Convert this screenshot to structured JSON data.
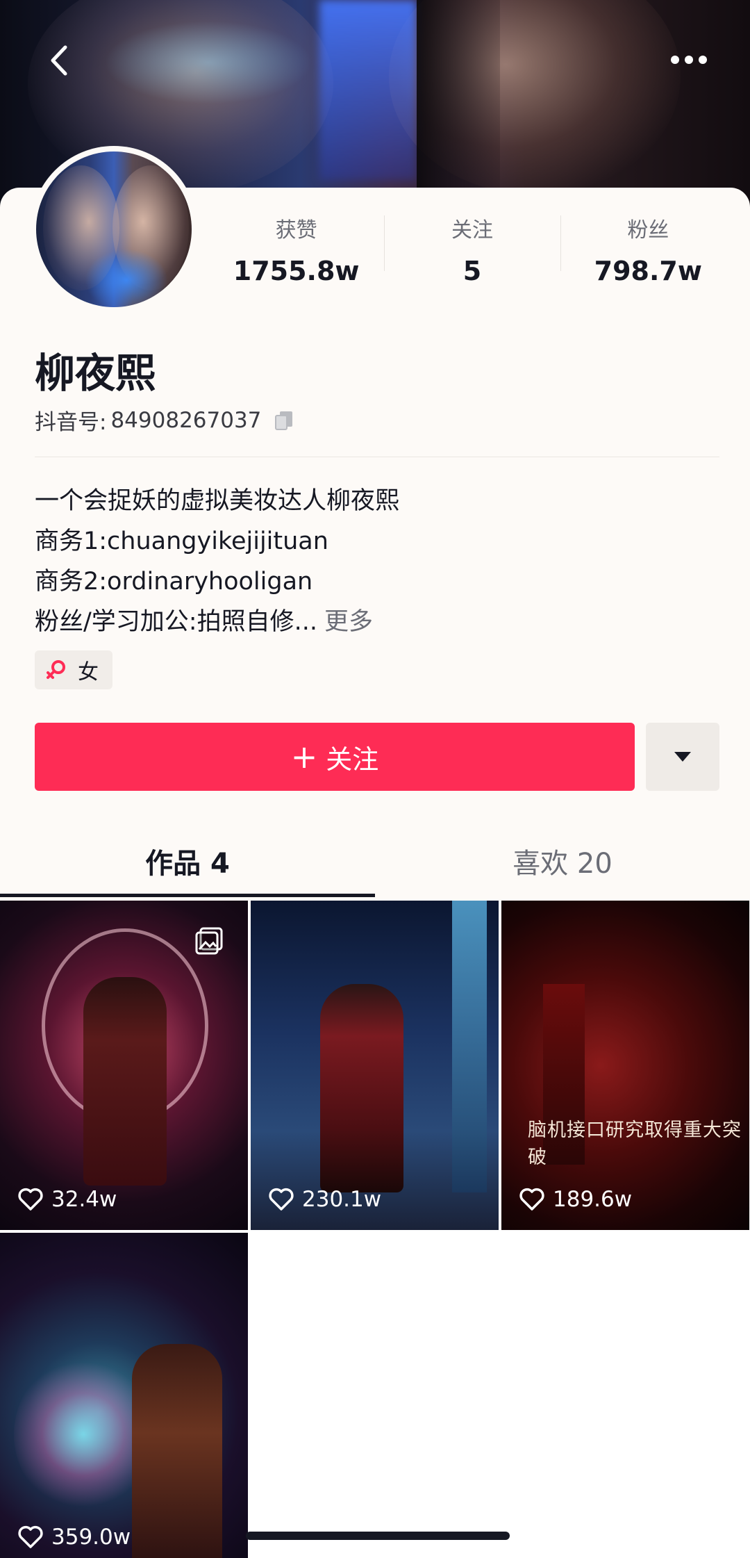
{
  "header": {
    "back_icon": "chevron-left-icon",
    "more_icon": "more-dots-icon"
  },
  "profile": {
    "stats": [
      {
        "label": "获赞",
        "value": "1755.8w"
      },
      {
        "label": "关注",
        "value": "5"
      },
      {
        "label": "粉丝",
        "value": "798.7w"
      }
    ],
    "name": "柳夜熙",
    "uid_label": "抖音号:",
    "uid_value": "84908267037",
    "bio_lines": [
      "一个会捉妖的虚拟美妆达人柳夜熙",
      "商务1:chuangyikejijituan",
      "商务2:ordinaryhooligan",
      "粉丝/学习加公:拍照自修..."
    ],
    "bio_more": "更多",
    "gender_tag": "女",
    "gender_color": "#fe2c55"
  },
  "actions": {
    "follow_plus": "+",
    "follow_label": "关注",
    "follow_color": "#fe2c55",
    "dropdown_icon": "caret-down-icon"
  },
  "tabs": [
    {
      "label": "作品 4",
      "active": true
    },
    {
      "label": "喜欢 20",
      "active": false
    }
  ],
  "videos": [
    {
      "likes": "32.4w",
      "has_image_icon": true
    },
    {
      "likes": "230.1w"
    },
    {
      "likes": "189.6w",
      "caption": "脑机接口研究取得重大突破"
    },
    {
      "likes": "359.0w"
    }
  ]
}
